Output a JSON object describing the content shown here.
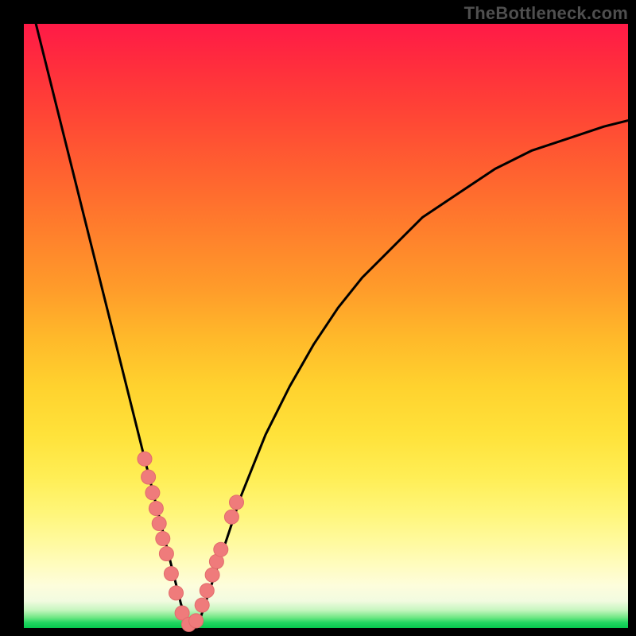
{
  "watermark": "TheBottleneck.com",
  "colors": {
    "curve": "#000000",
    "marker": "#ef7b7b",
    "markerStroke": "#e26c6c",
    "frame": "#000000"
  },
  "chart_data": {
    "type": "line",
    "title": "",
    "xlabel": "",
    "ylabel": "",
    "xlim": [
      0,
      100
    ],
    "ylim": [
      0,
      100
    ],
    "grid": false,
    "legend": false,
    "series": [
      {
        "name": "bottleneck-curve",
        "x": [
          2,
          4,
          6,
          8,
          10,
          12,
          14,
          16,
          18,
          20,
          21,
          22,
          23,
          24,
          25,
          26,
          27,
          28,
          29,
          30,
          32,
          34,
          36,
          38,
          40,
          44,
          48,
          52,
          56,
          60,
          66,
          72,
          78,
          84,
          90,
          96,
          100
        ],
        "y": [
          100,
          92,
          84,
          76,
          68,
          60,
          52,
          44,
          36,
          28,
          24,
          20,
          16,
          12,
          8,
          4,
          1,
          0,
          1,
          4,
          10,
          16,
          22,
          27,
          32,
          40,
          47,
          53,
          58,
          62,
          68,
          72,
          76,
          79,
          81,
          83,
          84
        ]
      }
    ],
    "markers": {
      "name": "sample-points",
      "x": [
        20.0,
        20.6,
        21.3,
        21.9,
        22.4,
        23.0,
        23.6,
        24.4,
        25.2,
        26.2,
        27.3,
        28.5,
        29.5,
        30.3,
        31.2,
        31.9,
        32.6,
        34.4,
        35.2
      ],
      "y": [
        28.0,
        25.0,
        22.4,
        19.8,
        17.3,
        14.8,
        12.3,
        9.0,
        5.8,
        2.5,
        0.6,
        1.2,
        3.8,
        6.2,
        8.8,
        11.0,
        13.0,
        18.4,
        20.8
      ],
      "r": 9
    }
  }
}
